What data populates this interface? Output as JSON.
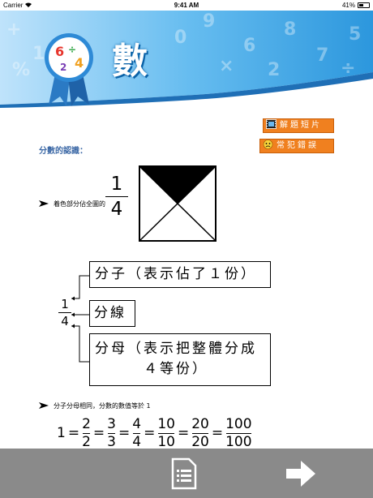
{
  "status_bar": {
    "carrier": "Carrier",
    "time": "9:41 AM",
    "battery": "41%"
  },
  "header": {
    "title": "數",
    "badge_icon": "math-numbers-rosette-icon",
    "accent": "#1f8fd8"
  },
  "buttons": {
    "video": "解題短片",
    "mistakes": "常犯錯誤",
    "color": "#f0801f"
  },
  "content": {
    "section_title": "分數的認識：",
    "bullet1": "着色部分佔全圖的",
    "fraction_big": {
      "num": "1",
      "den": "4"
    },
    "diagram": {
      "fraction": {
        "num": "1",
        "den": "4"
      },
      "numerator_box": "分子（表示佔了１份）",
      "line_box": "分線",
      "denominator_box_line1": "分母（表示把整體分成",
      "denominator_box_line2": "４等份）"
    },
    "bullet2": "分子分母相同，分數的數值等於 1",
    "equation": {
      "lead": "1",
      "eq": "=",
      "fractions": [
        {
          "num": "2",
          "den": "2"
        },
        {
          "num": "3",
          "den": "3"
        },
        {
          "num": "4",
          "den": "4"
        },
        {
          "num": "10",
          "den": "10"
        },
        {
          "num": "20",
          "den": "20"
        },
        {
          "num": "100",
          "den": "100"
        }
      ]
    }
  },
  "bottom_bar": {
    "left_icon": "document-list-icon",
    "right_icon": "next-arrow-icon"
  }
}
